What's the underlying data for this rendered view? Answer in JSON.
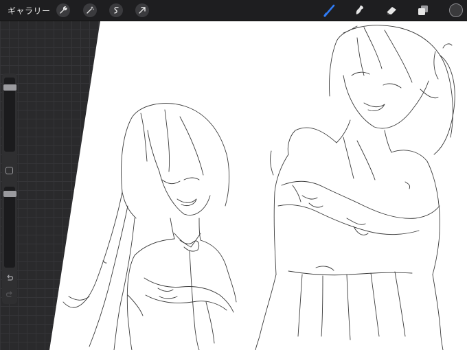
{
  "topbar": {
    "gallery_label": "ギャラリー",
    "left_tools": [
      "wrench-icon",
      "magic-wand-icon",
      "selection-icon",
      "transform-arrow-icon"
    ],
    "right_tools": [
      "brush-icon",
      "smudge-icon",
      "eraser-icon",
      "layers-icon"
    ],
    "active_tool": "brush-icon",
    "accent_color": "#2f7bf5",
    "current_color": "#3a3a3c"
  },
  "sidebar": {
    "size_slider_value": 0.08,
    "opacity_slider_value": 0.05,
    "undo_icon": "undo-icon",
    "redo_icon": "redo-icon"
  },
  "canvas": {
    "background": "#ffffff",
    "content": "line-art-sketch"
  }
}
